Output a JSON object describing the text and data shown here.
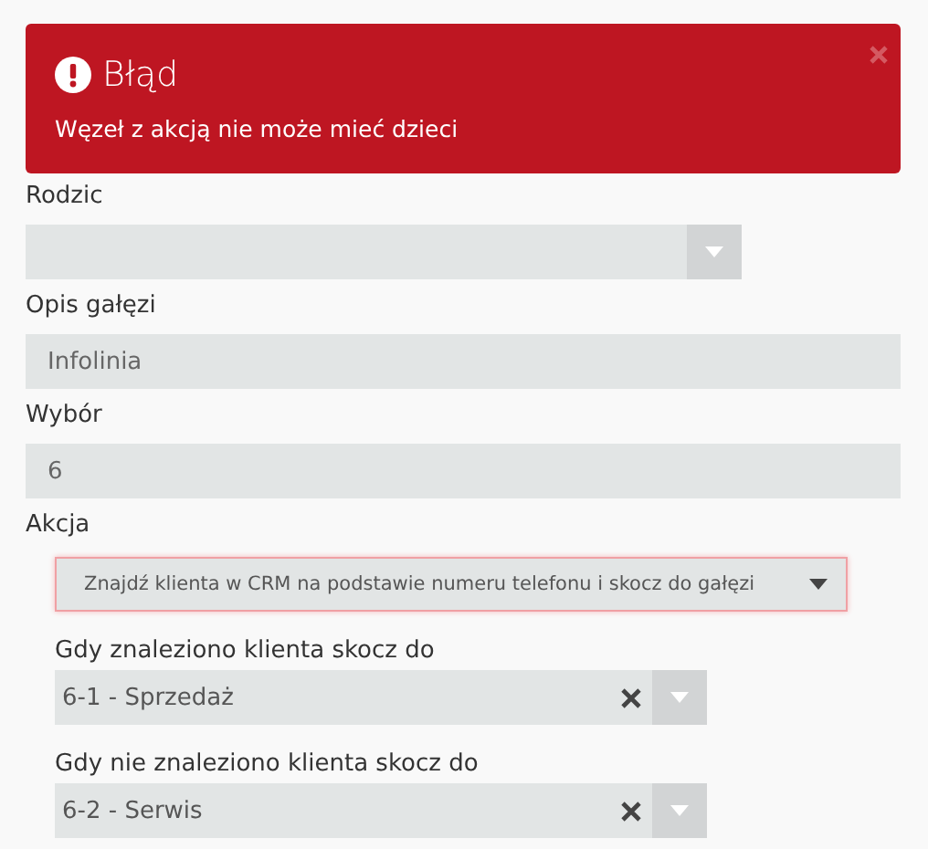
{
  "alert": {
    "title": "Błąd",
    "message": "Węzeł z akcją nie może mieć dzieci"
  },
  "fields": [
    {
      "label": "Rodzic",
      "kind": "combo"
    },
    {
      "label": "Opis gałęzi",
      "kind": "text",
      "value": "Infolinia"
    },
    {
      "label": "Wybór",
      "kind": "text",
      "value": "6"
    },
    {
      "label": "Akcja",
      "kind": "select",
      "value": "Znajdź klienta w CRM na podstawie numeru telefonu i skocz do gałęzi",
      "invalid": true,
      "children": [
        {
          "label": "Gdy znaleziono klienta skocz do",
          "kind": "combo",
          "value": "6-1 - Sprzedaż",
          "clearable": true
        },
        {
          "label": "Gdy nie znaleziono klienta skocz do",
          "kind": "combo",
          "value": "6-2 - Serwis",
          "clearable": true
        }
      ]
    }
  ]
}
